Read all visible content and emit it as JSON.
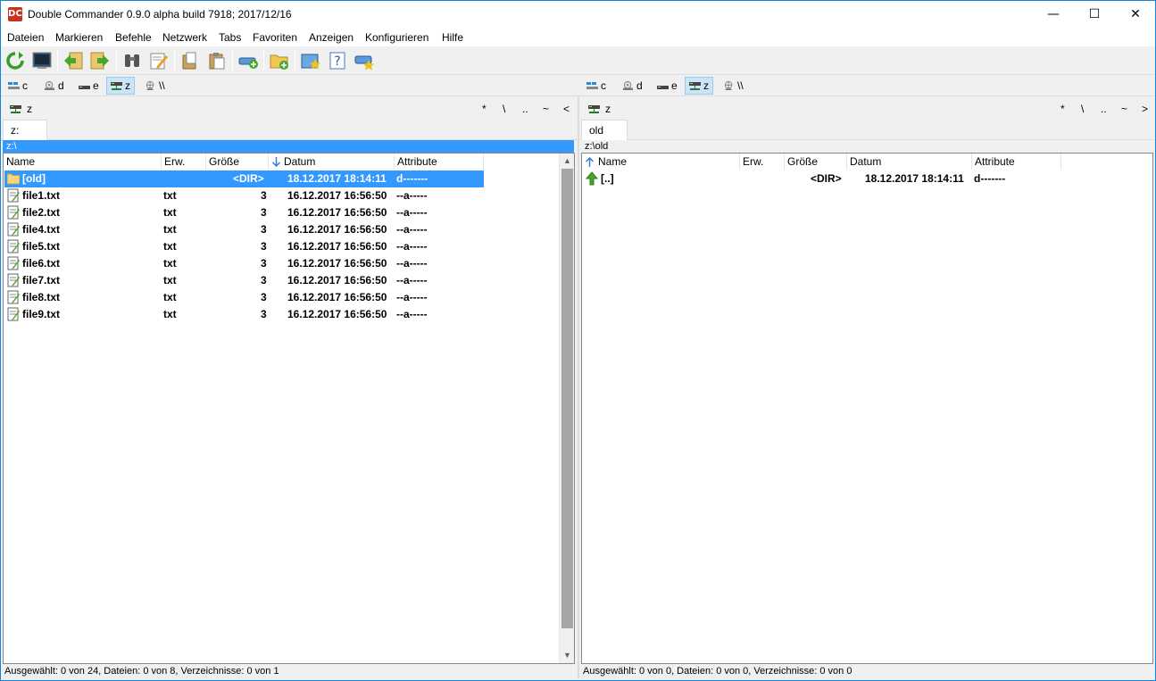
{
  "window": {
    "title": "Double Commander 0.9.0 alpha build 7918; 2017/12/16",
    "app_icon_text": "DC",
    "minimize": "—",
    "maximize": "☐",
    "close": "✕"
  },
  "menu": [
    "Dateien",
    "Markieren",
    "Befehle",
    "Netzwerk",
    "Tabs",
    "Favoriten",
    "Anzeigen",
    "Konfigurieren",
    "Hilfe"
  ],
  "toolbar_icons": [
    "refresh-icon",
    "terminal-icon",
    "back-icon",
    "forward-icon",
    "search-icon",
    "edit-icon",
    "copy-icon",
    "paste-icon",
    "network-connect-icon",
    "new-folder-icon",
    "favorites-icon",
    "help-icon",
    "network-favorites-icon"
  ],
  "drives": {
    "left": [
      {
        "label": "c",
        "icon": "system-drive-icon",
        "active": false
      },
      {
        "label": "d",
        "icon": "cd-drive-icon",
        "active": false
      },
      {
        "label": "e",
        "icon": "removable-drive-icon",
        "active": false
      },
      {
        "label": "z",
        "icon": "network-drive-icon",
        "active": true
      },
      {
        "label": "\\\\",
        "icon": "network-icon",
        "active": false
      }
    ],
    "right": [
      {
        "label": "c",
        "icon": "system-drive-icon",
        "active": false
      },
      {
        "label": "d",
        "icon": "cd-drive-icon",
        "active": false
      },
      {
        "label": "e",
        "icon": "removable-drive-icon",
        "active": false
      },
      {
        "label": "z",
        "icon": "network-drive-icon",
        "active": true
      },
      {
        "label": "\\\\",
        "icon": "network-icon",
        "active": false
      }
    ]
  },
  "left_panel": {
    "drive_label": "z",
    "nav_symbols": [
      "*",
      "\\",
      "..",
      "~",
      "<"
    ],
    "tab_label": "z:",
    "current_path": "z:\\",
    "columns": [
      "Name",
      "Erw.",
      "Größe",
      "Datum",
      "Attribute"
    ],
    "rows": [
      {
        "name": "[old]",
        "ext": "",
        "size": "<DIR>",
        "date": "18.12.2017 18:14:11",
        "attr": "d-------",
        "type": "folder",
        "selected": true
      },
      {
        "name": "file1.txt",
        "ext": "txt",
        "size": "3",
        "date": "16.12.2017 16:56:50",
        "attr": "--a-----",
        "type": "file",
        "selected": false
      },
      {
        "name": "file2.txt",
        "ext": "txt",
        "size": "3",
        "date": "16.12.2017 16:56:50",
        "attr": "--a-----",
        "type": "file",
        "selected": false
      },
      {
        "name": "file4.txt",
        "ext": "txt",
        "size": "3",
        "date": "16.12.2017 16:56:50",
        "attr": "--a-----",
        "type": "file",
        "selected": false
      },
      {
        "name": "file5.txt",
        "ext": "txt",
        "size": "3",
        "date": "16.12.2017 16:56:50",
        "attr": "--a-----",
        "type": "file",
        "selected": false
      },
      {
        "name": "file6.txt",
        "ext": "txt",
        "size": "3",
        "date": "16.12.2017 16:56:50",
        "attr": "--a-----",
        "type": "file",
        "selected": false
      },
      {
        "name": "file7.txt",
        "ext": "txt",
        "size": "3",
        "date": "16.12.2017 16:56:50",
        "attr": "--a-----",
        "type": "file",
        "selected": false
      },
      {
        "name": "file8.txt",
        "ext": "txt",
        "size": "3",
        "date": "16.12.2017 16:56:50",
        "attr": "--a-----",
        "type": "file",
        "selected": false
      },
      {
        "name": "file9.txt",
        "ext": "txt",
        "size": "3",
        "date": "16.12.2017 16:56:50",
        "attr": "--a-----",
        "type": "file",
        "selected": false
      }
    ],
    "status": "Ausgewählt: 0 von 24, Dateien: 0 von 8, Verzeichnisse: 0 von 1"
  },
  "right_panel": {
    "drive_label": "z",
    "nav_symbols": [
      "*",
      "\\",
      "..",
      "~",
      ">"
    ],
    "tab_label": "old",
    "current_path": "z:\\old",
    "columns": [
      "Name",
      "Erw.",
      "Größe",
      "Datum",
      "Attribute"
    ],
    "rows": [
      {
        "name": "[..]",
        "ext": "",
        "size": "<DIR>",
        "date": "18.12.2017 18:14:11",
        "attr": "d-------",
        "type": "up",
        "selected": false
      }
    ],
    "status": "Ausgewählt: 0 von 0, Dateien: 0 von 0, Verzeichnisse: 0 von 0"
  }
}
